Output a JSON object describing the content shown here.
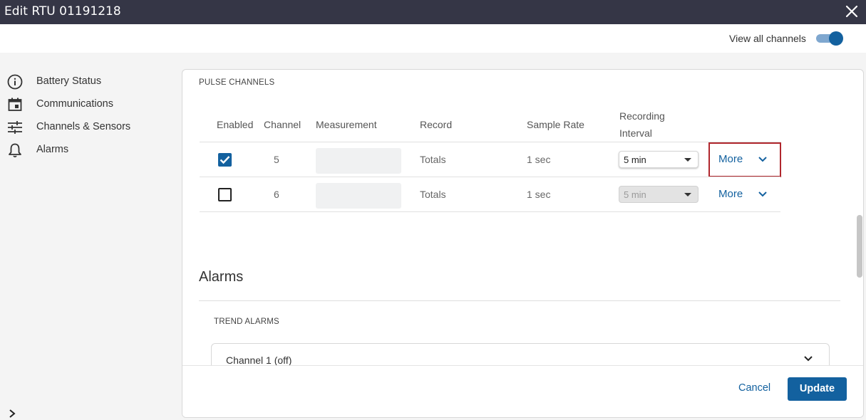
{
  "window": {
    "title": "Edit RTU 01191218",
    "close_icon": "close-icon"
  },
  "topbar": {
    "view_all_label": "View all channels",
    "view_all_on": true
  },
  "sidebar": {
    "items": [
      {
        "label": "Battery Status",
        "icon": "info-icon"
      },
      {
        "label": "Communications",
        "icon": "calendar-icon"
      },
      {
        "label": "Channels & Sensors",
        "icon": "sliders-icon"
      },
      {
        "label": "Alarms",
        "icon": "bell-icon"
      }
    ],
    "expand_icon": "chevron-right-icon"
  },
  "pulse": {
    "section_label": "PULSE CHANNELS",
    "headers": {
      "enabled": "Enabled",
      "channel": "Channel",
      "measurement": "Measurement",
      "record": "Record",
      "sample_rate": "Sample Rate",
      "recording_interval_1": "Recording",
      "recording_interval_2": "Interval"
    },
    "rows": [
      {
        "enabled": true,
        "channel": "5",
        "measurement": "",
        "record": "Totals",
        "sample_rate": "1 sec",
        "interval": "5 min",
        "interval_disabled": false,
        "more": "More"
      },
      {
        "enabled": false,
        "channel": "6",
        "measurement": "",
        "record": "Totals",
        "sample_rate": "1 sec",
        "interval": "5 min",
        "interval_disabled": true,
        "more": "More"
      }
    ]
  },
  "alarms": {
    "title": "Alarms",
    "section_label": "TREND ALARMS",
    "accordion_label": "Channel 1 (off)"
  },
  "footer": {
    "cancel": "Cancel",
    "update": "Update"
  },
  "colors": {
    "primary": "#13619f",
    "titlebar": "#353646",
    "highlight": "#b0272d"
  }
}
